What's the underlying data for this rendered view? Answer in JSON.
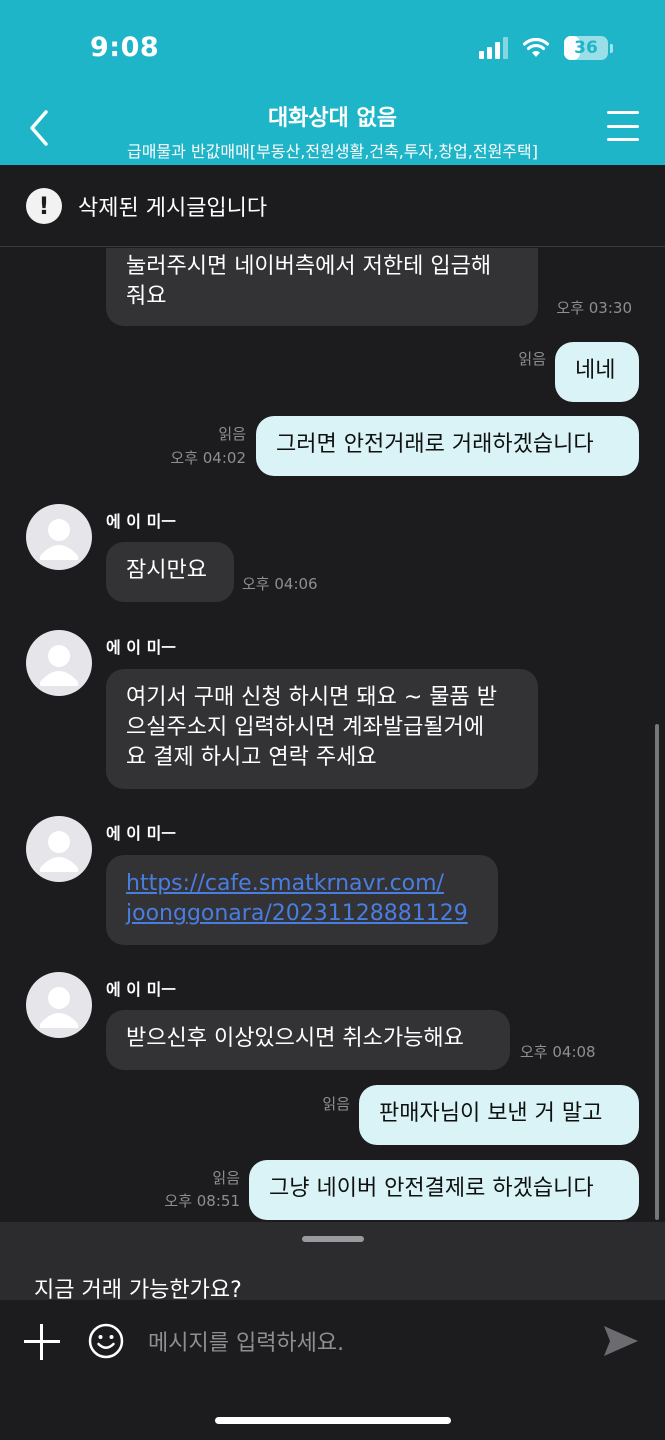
{
  "status_bar": {
    "time": "9:08",
    "battery": "36",
    "battery_percent": 36
  },
  "header": {
    "title": "대화상대 없음",
    "subtitle": "급매물과 반값매매[부동산,전원생활,건축,투자,창업,전원주택]",
    "back_icon": "chevron-left-icon",
    "menu_icon": "hamburger-menu-icon"
  },
  "notice": {
    "text": "삭제된 게시글입니다",
    "icon": "exclamation-circle-icon"
  },
  "messages": {
    "m1": {
      "partial_text": "눌러주시면 네이버측에서 저한테 입금해\n줘요",
      "time": "오후 03:30"
    },
    "m2": {
      "read": "읽음",
      "text": "네네"
    },
    "m3": {
      "read": "읽음",
      "time": "오후 04:02",
      "text": "그러면 안전거래로 거래하겠습니다"
    },
    "m4": {
      "sender": "에 이 미ㅡ",
      "text": "잠시만요",
      "time": "오후 04:06"
    },
    "m5": {
      "sender": "에 이 미ㅡ",
      "text": "여기서 구매 신청 하시면 돼요 ~ 물품 받\n으실주소지 입력하시면 계좌발급될거에\n요 결제 하시고 연락 주세요"
    },
    "m6": {
      "sender": "에 이 미ㅡ",
      "link_line1": "https://cafe.smatkrnavr.com/",
      "link_line2": "joonggonara/20231128881129"
    },
    "m7": {
      "sender": "에 이 미ㅡ",
      "text": "받으신후 이상있으시면 취소가능해요",
      "time": "오후 04:08"
    },
    "m8": {
      "read": "읽음",
      "text": "판매자님이 보낸 거 말고"
    },
    "m9": {
      "read": "읽음",
      "time": "오후 08:51",
      "text": "그냥 네이버 안전결제로 하겠습니다"
    }
  },
  "suggestion": {
    "text": "지금 거래 가능한가요?"
  },
  "input_bar": {
    "placeholder": "메시지를 입력하세요.",
    "plus_icon": "plus-icon",
    "emoji_icon": "smiley-icon",
    "send_icon": "send-icon"
  },
  "colors": {
    "header_bg": "#1fb5c9",
    "outgoing_bubble": "#d9f3f6",
    "incoming_bubble": "#333336",
    "link": "#4a7de0"
  }
}
